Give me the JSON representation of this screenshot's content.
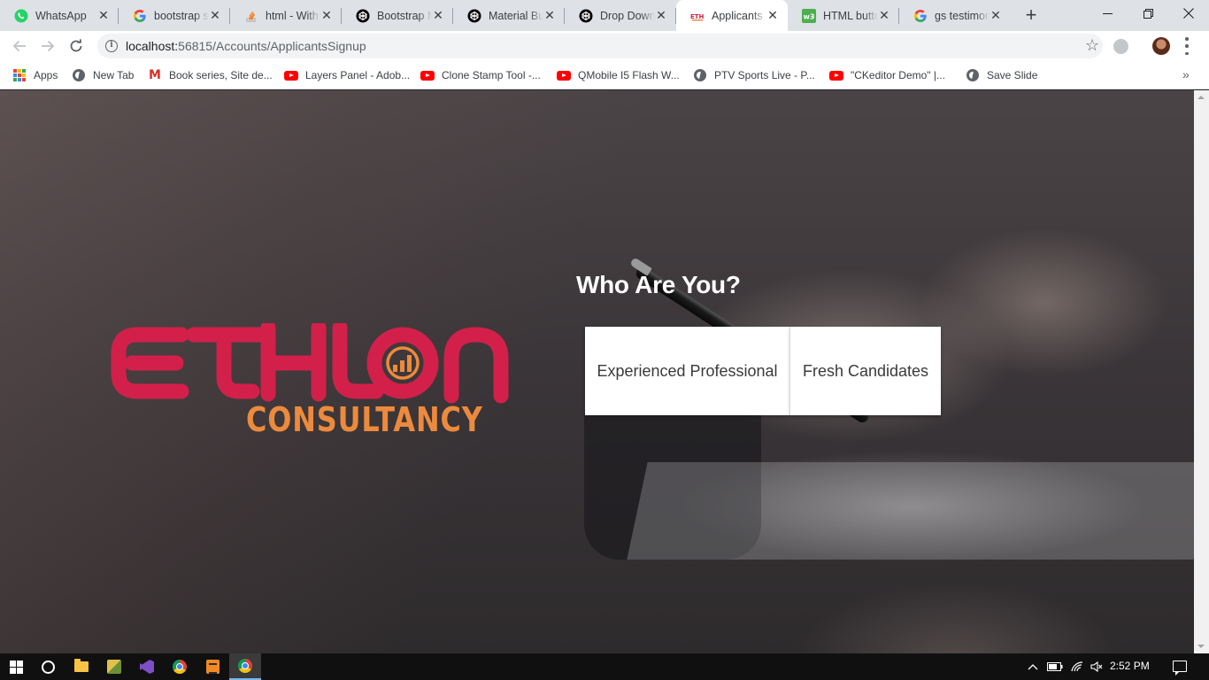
{
  "browser": {
    "tabs": [
      {
        "title": "WhatsApp",
        "icon": "whatsapp-icon",
        "active": false
      },
      {
        "title": "bootstrap s",
        "icon": "google-icon",
        "active": false
      },
      {
        "title": "html - With",
        "icon": "stackoverflow-icon",
        "active": false
      },
      {
        "title": "Bootstrap M",
        "icon": "codepen-icon",
        "active": false
      },
      {
        "title": "Material Bu",
        "icon": "codepen-icon",
        "active": false
      },
      {
        "title": "Drop Down",
        "icon": "codepen-icon",
        "active": false
      },
      {
        "title": "Applicants |",
        "icon": "ethlon-icon",
        "active": true
      },
      {
        "title": "HTML butto",
        "icon": "w3schools-icon",
        "active": false
      },
      {
        "title": "gs testimon",
        "icon": "google-icon",
        "active": false
      }
    ],
    "close_glyph": "✕",
    "new_tab_glyph": "+",
    "address": {
      "host": "localhost:",
      "path": "56815/Accounts/ApplicantsSignup"
    },
    "bookmarks": [
      {
        "label": "Apps",
        "icon": "apps-grid-icon"
      },
      {
        "label": "New Tab",
        "icon": "globe-icon"
      },
      {
        "label": "Book series, Site de...",
        "icon": "gmail-icon"
      },
      {
        "label": "Layers Panel - Adob...",
        "icon": "youtube-icon"
      },
      {
        "label": "Clone Stamp Tool -...",
        "icon": "youtube-icon"
      },
      {
        "label": "QMobile I5 Flash W...",
        "icon": "youtube-icon"
      },
      {
        "label": "PTV Sports Live - P...",
        "icon": "globe-icon"
      },
      {
        "label": "\"CKeditor Demo\" |...",
        "icon": "youtube-icon"
      },
      {
        "label": "Save Slide",
        "icon": "globe-icon"
      }
    ],
    "bookmarks_overflow": "»"
  },
  "page": {
    "brand": {
      "name": "ETHLON",
      "sub": "CONSULTANCY",
      "primary_color": "#d2204a",
      "secondary_color": "#ec8a3d"
    },
    "heading": "Who Are You?",
    "options": {
      "experienced": "Experienced Professional",
      "fresh": "Fresh Candidates"
    }
  },
  "taskbar": {
    "clock": "2:52 PM",
    "apps": [
      "start-icon",
      "cortana-icon",
      "file-explorer-icon",
      "tools-icon",
      "visual-studio-icon",
      "chrome-icon",
      "sublime-text-icon",
      "chrome-icon"
    ]
  }
}
